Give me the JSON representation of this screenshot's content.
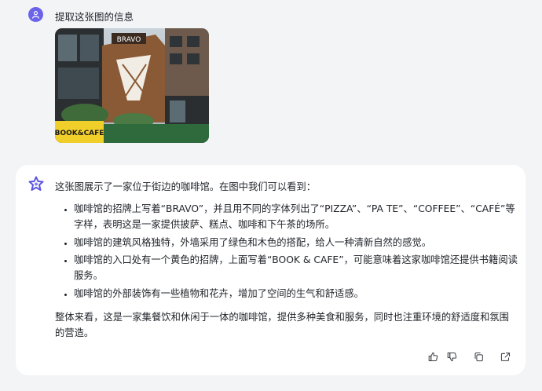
{
  "user_message": {
    "avatar_icon": "user-icon",
    "text": "提取这张图的信息",
    "image": {
      "sign_text": "BRAVO",
      "shop_sign": "BOOK&CAFE"
    }
  },
  "assistant_message": {
    "avatar_icon": "assistant-logo-icon",
    "intro": "这张图展示了一家位于街边的咖啡馆。在图中我们可以看到：",
    "bullets": [
      "咖啡馆的招牌上写着“BRAVO”，并且用不同的字体列出了“PIZZA”、“PA TE”、“COFFEE”、“CAFÉ”等字样，表明这是一家提供披萨、糕点、咖啡和下午茶的场所。",
      "咖啡馆的建筑风格独特，外墙采用了绿色和木色的搭配，给人一种清新自然的感觉。",
      "咖啡馆的入口处有一个黄色的招牌，上面写着“BOOK & CAFE”，可能意味着这家咖啡馆还提供书籍阅读服务。",
      "咖啡馆的外部装饰有一些植物和花卉，增加了空间的生气和舒适感。"
    ],
    "conclusion": "整体来看，这是一家集餐饮和休闲于一体的咖啡馆，提供多种美食和服务，同时也注重环境的舒适度和氛围的营造。"
  },
  "actions": {
    "like_icon": "thumbs-up-icon",
    "dislike_icon": "thumbs-down-icon",
    "copy_icon": "copy-icon",
    "share_icon": "share-icon"
  },
  "colors": {
    "page_bg": "#f3f4f6",
    "card_bg": "#ffffff",
    "accent": "#6b63e8"
  }
}
